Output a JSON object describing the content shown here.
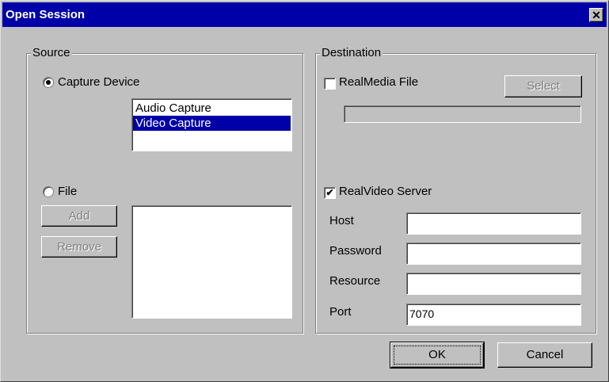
{
  "window": {
    "title": "Open Session"
  },
  "source": {
    "group_label": "Source",
    "capture_device": {
      "label": "Capture Device",
      "selected": true
    },
    "devices": [
      {
        "label": "Audio Capture",
        "selected": false
      },
      {
        "label": "Video Capture",
        "selected": true
      }
    ],
    "file": {
      "label": "File",
      "selected": false
    },
    "add_label": "Add",
    "remove_label": "Remove"
  },
  "destination": {
    "group_label": "Destination",
    "realmedia_file": {
      "label": "RealMedia File",
      "checked": false
    },
    "select_label": "Select",
    "realvideo_server": {
      "label": "RealVideo Server",
      "checked": true
    },
    "host_label": "Host",
    "host_value": "",
    "password_label": "Password",
    "password_value": "",
    "resource_label": "Resource",
    "resource_value": "",
    "port_label": "Port",
    "port_value": "7070"
  },
  "footer": {
    "ok_label": "OK",
    "cancel_label": "Cancel"
  },
  "colors": {
    "face": "#c0c0c0",
    "titlebar": "#0000a8",
    "selection": "#0000a8"
  }
}
